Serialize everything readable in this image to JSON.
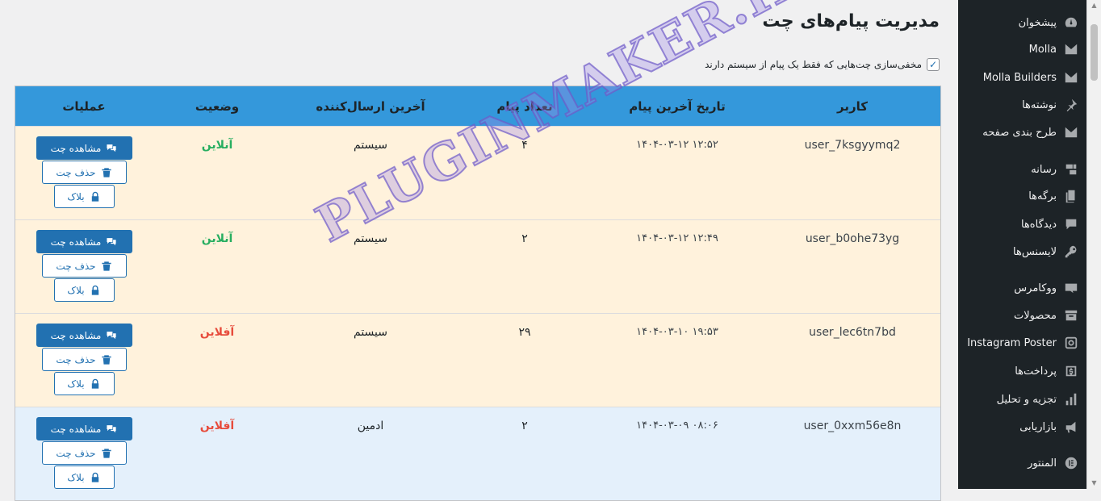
{
  "page": {
    "title": "مدیریت پیام‌های چت",
    "filter_label": "مخفی‌سازی چت‌هایی که فقط یک پیام از سیستم دارند",
    "filter_checked": true
  },
  "table": {
    "headers": {
      "user": "کاربر",
      "last_date": "تاریخ آخرین پیام",
      "count": "تعداد پیام",
      "last_sender": "آخرین ارسال‌کننده",
      "status": "وضعیت",
      "ops": "عملیات"
    },
    "rows": [
      {
        "user": "user_7ksgyymq2",
        "date": "۱۴۰۴-۰۳-۱۲ ۱۲:۵۲",
        "count": "۴",
        "sender": "سیستم",
        "status": "آنلاین"
      },
      {
        "user": "user_b0ohe73yg",
        "date": "۱۴۰۴-۰۳-۱۲ ۱۲:۴۹",
        "count": "۲",
        "sender": "سیستم",
        "status": "آنلاین"
      },
      {
        "user": "user_lec6tn7bd",
        "date": "۱۴۰۴-۰۳-۱۰ ۱۹:۵۳",
        "count": "۲۹",
        "sender": "سیستم",
        "status": "آفلاین"
      },
      {
        "user": "user_0xxm56e8n",
        "date": "۱۴۰۴-۰۳-۰۹ ۰۸:۰۶",
        "count": "۲",
        "sender": "ادمین",
        "status": "آفلاین"
      }
    ],
    "actions": {
      "view": "مشاهده چت",
      "delete": "حذف چت",
      "block": "بلاک"
    }
  },
  "colors": {
    "header_bg": "#3498db",
    "system_row": "#fff2dc",
    "admin_row": "#e4f0fb",
    "online": "#27ae60",
    "offline": "#e74c3c",
    "button": "#2271b1"
  },
  "sidebar": {
    "items": [
      {
        "label": "پیشخوان",
        "icon": "dashboard-icon"
      },
      {
        "label": "Molla",
        "icon": "molla-icon"
      },
      {
        "label": "Molla Builders",
        "icon": "molla-icon"
      },
      {
        "label": "نوشته‌ها",
        "icon": "pin-icon"
      },
      {
        "label": "طرح بندی صفحه",
        "icon": "molla-icon"
      },
      {
        "label": "رسانه",
        "icon": "media-icon"
      },
      {
        "label": "برگه‌ها",
        "icon": "pages-icon"
      },
      {
        "label": "دیدگاه‌ها",
        "icon": "comment-icon"
      },
      {
        "label": "لایسنس‌ها",
        "icon": "key-icon"
      },
      {
        "label": "ووکامرس",
        "icon": "woo-icon"
      },
      {
        "label": "محصولات",
        "icon": "archive-icon"
      },
      {
        "label": "Instagram Poster",
        "icon": "instagram-icon"
      },
      {
        "label": "پرداخت‌ها",
        "icon": "dollar-icon"
      },
      {
        "label": "تجزیه و تحلیل",
        "icon": "chart-icon"
      },
      {
        "label": "بازاریابی",
        "icon": "megaphone-icon"
      },
      {
        "label": "المنتور",
        "icon": "elementor-icon"
      }
    ]
  },
  "watermark": "PLUGINMAKER.IR"
}
